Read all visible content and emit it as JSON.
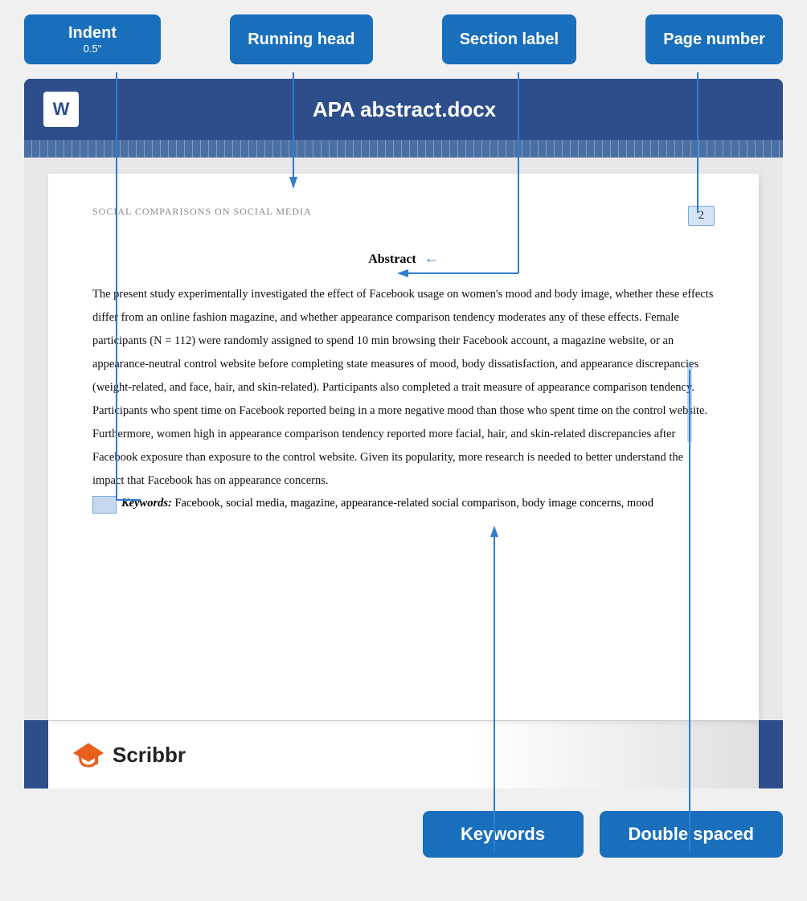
{
  "buttons": {
    "indent": "Indent",
    "indent_sub": "0.5\"",
    "running_head": "Running head",
    "section_label": "Section label",
    "page_number": "Page number",
    "keywords": "Keywords",
    "double_spaced": "Double spaced"
  },
  "document": {
    "title": "APA abstract.docx",
    "word_icon": "W",
    "running_head_text": "SOCIAL COMPARISONS ON SOCIAL MEDIA",
    "page_number": "2",
    "section_heading": "Abstract",
    "body_text": "The present study experimentally investigated the effect of Facebook usage on women's mood and body image, whether these effects differ from an online fashion magazine, and whether appearance comparison tendency moderates any of these effects. Female participants (N = 112) were randomly assigned to spend 10 min browsing their Facebook account, a magazine website, or an appearance-neutral control website before completing state measures of mood, body dissatisfaction, and appearance discrepancies (weight-related, and face, hair, and skin-related). Participants also completed a trait measure of appearance comparison tendency. Participants who spent time on Facebook reported being in a more negative mood than those who spent time on the control website. Furthermore, women high in appearance comparison tendency reported more facial, hair, and skin-related discrepancies after Facebook exposure than exposure to the control website. Given its popularity, more research is needed to better understand the impact that Facebook has on appearance concerns.",
    "keywords_label": "Keywords:",
    "keywords_text": "Facebook, social media, magazine, appearance-related social comparison, body image concerns, mood"
  },
  "scribbr": {
    "name": "Scribbr"
  }
}
